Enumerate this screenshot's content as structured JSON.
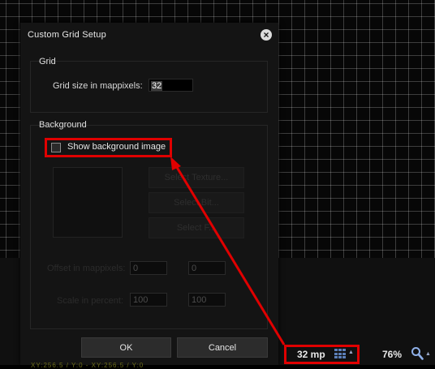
{
  "dialog": {
    "title": "Custom Grid Setup",
    "grid_group": {
      "title": "Grid",
      "size_label": "Grid size in mappixels:",
      "size_value": "32"
    },
    "background_group": {
      "title": "Background",
      "show_image_label": "Show background image",
      "show_image_checked": false,
      "select_texture_label": "Select Texture...",
      "select_button2_label": "Select Bit...",
      "select_button3_label": "Select F...",
      "offset_label": "Offset in mappixels:",
      "offset_x": "0",
      "offset_y": "0",
      "scale_label": "Scale in percent:",
      "scale_x": "100",
      "scale_y": "100"
    },
    "ok_label": "OK",
    "cancel_label": "Cancel"
  },
  "statusbar": {
    "grid_size": "32 mp",
    "zoom": "76%",
    "cutoff_text": "XY:256.5 / Y:0 - XY:256.5 / Y:0"
  },
  "colors": {
    "highlight": "#e00000",
    "dialog_bg": "#141414",
    "accent_blue": "#5b7fb8"
  },
  "icons": [
    "close-icon",
    "grid-icon",
    "magnifier-icon",
    "caret-up-icon"
  ]
}
